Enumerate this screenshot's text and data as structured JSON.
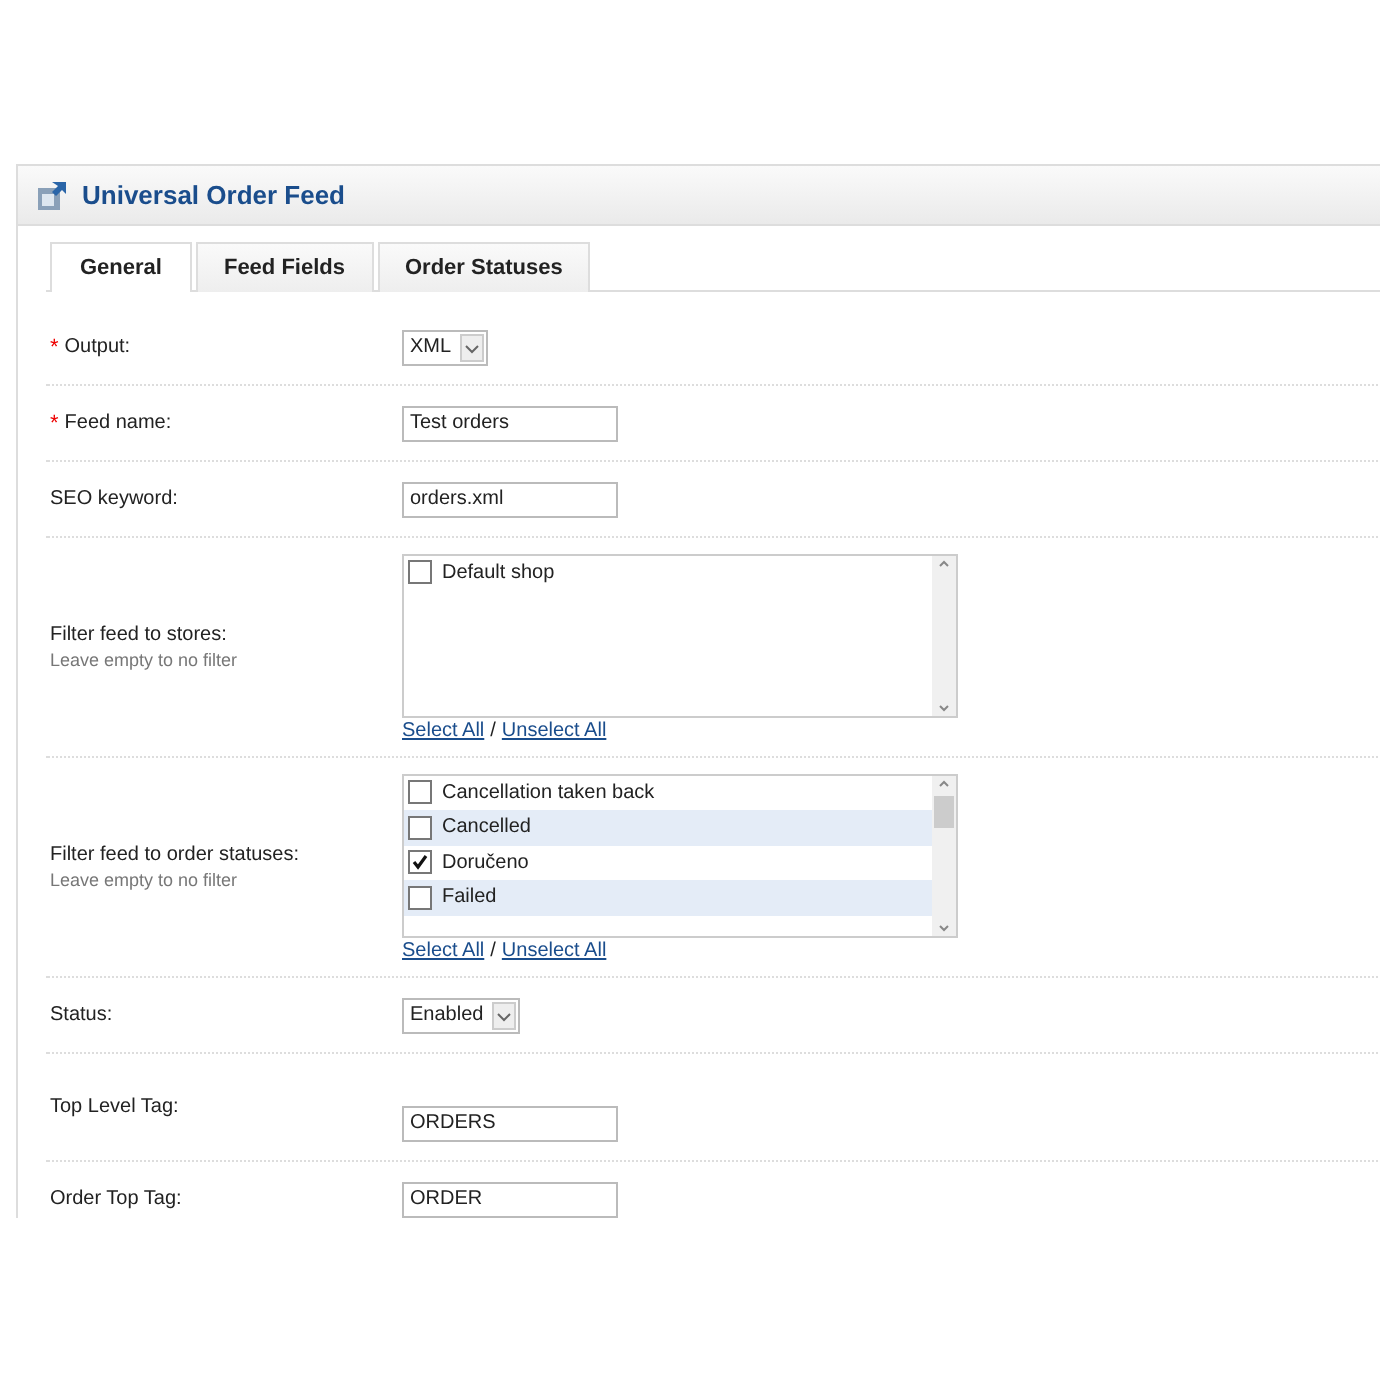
{
  "panel": {
    "title": "Universal Order Feed"
  },
  "tabs": [
    {
      "label": "General",
      "selected": true
    },
    {
      "label": "Feed Fields",
      "selected": false
    },
    {
      "label": "Order Statuses",
      "selected": false
    }
  ],
  "rows": [
    {
      "kind": "select",
      "marker": "*",
      "label": "Output:",
      "value": "XML"
    },
    {
      "kind": "text",
      "marker": "*",
      "label": "Feed name:",
      "value": "Test orders"
    },
    {
      "kind": "text",
      "label": "SEO keyword:",
      "value": "orders.xml"
    },
    {
      "kind": "checklist",
      "label": "Filter feed to stores:",
      "hint": "Leave empty to no filter",
      "items": [
        {
          "label": "Default shop",
          "checked": false
        }
      ],
      "select_all": "Select All",
      "separator": "/",
      "unselect_all": "Unselect All"
    },
    {
      "kind": "checklist",
      "label": "Filter feed to order statuses:",
      "hint": "Leave empty to no filter",
      "items": [
        {
          "label": "Cancellation taken back",
          "checked": false
        },
        {
          "label": "Cancelled",
          "checked": false
        },
        {
          "label": "Doručeno",
          "checked": true
        },
        {
          "label": "Failed",
          "checked": false
        }
      ],
      "select_all": "Select All",
      "separator": "/",
      "unselect_all": "Unselect All"
    },
    {
      "kind": "select",
      "label": "Status:",
      "value": "Enabled"
    },
    {
      "kind": "text",
      "label": "Top Level Tag:",
      "value": "ORDERS"
    },
    {
      "kind": "text",
      "label": "Order Top Tag:",
      "value": "ORDER"
    }
  ]
}
